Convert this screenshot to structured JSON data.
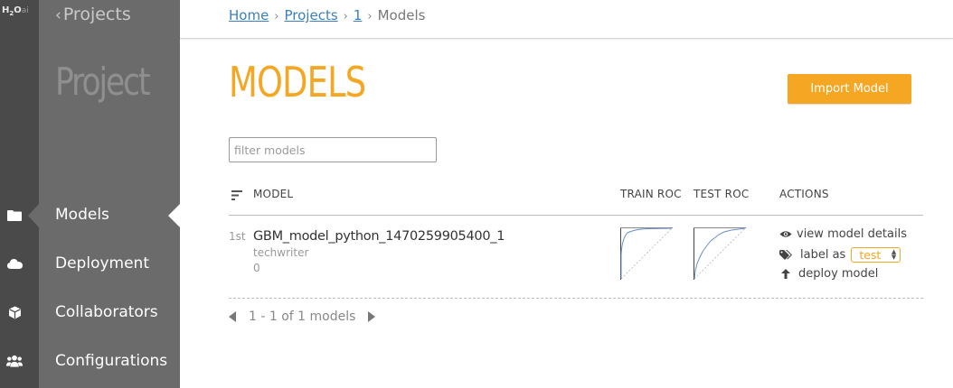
{
  "logo": {
    "brand": "H",
    "sub": "2",
    "o": "O",
    "ai": "ai"
  },
  "sidebar": {
    "back_label": "Projects",
    "title": "Project",
    "items": [
      {
        "label": "Models",
        "icon": "folder-icon",
        "active": true
      },
      {
        "label": "Deployment",
        "icon": "cloud-icon",
        "active": false
      },
      {
        "label": "Collaborators",
        "icon": "cube-icon",
        "active": false
      },
      {
        "label": "Configurations",
        "icon": "users-icon",
        "active": false
      }
    ]
  },
  "breadcrumb": {
    "items": [
      "Home",
      "Projects",
      "1"
    ],
    "current": "Models"
  },
  "main": {
    "title": "MODELS",
    "import_button": "Import Model",
    "filter_placeholder": "filter models",
    "columns": {
      "sort_icon": "sort-icon",
      "model": "MODEL",
      "train_roc": "TRAIN ROC",
      "test_roc": "TEST ROC",
      "actions": "ACTIONS"
    },
    "rows": [
      {
        "rank": "1st",
        "name": "GBM_model_python_1470259905400_1",
        "owner": "techwriter",
        "count": "0",
        "actions": {
          "view": "view model details",
          "label_as": "label as",
          "label_value": "test",
          "deploy": "deploy model"
        }
      }
    ],
    "pagination": "1 - 1 of 1 models"
  },
  "colors": {
    "accent": "#f5a623",
    "link": "#3a7fc1",
    "sidebar": "#6b6b6b",
    "rail": "#4a4a4a"
  }
}
